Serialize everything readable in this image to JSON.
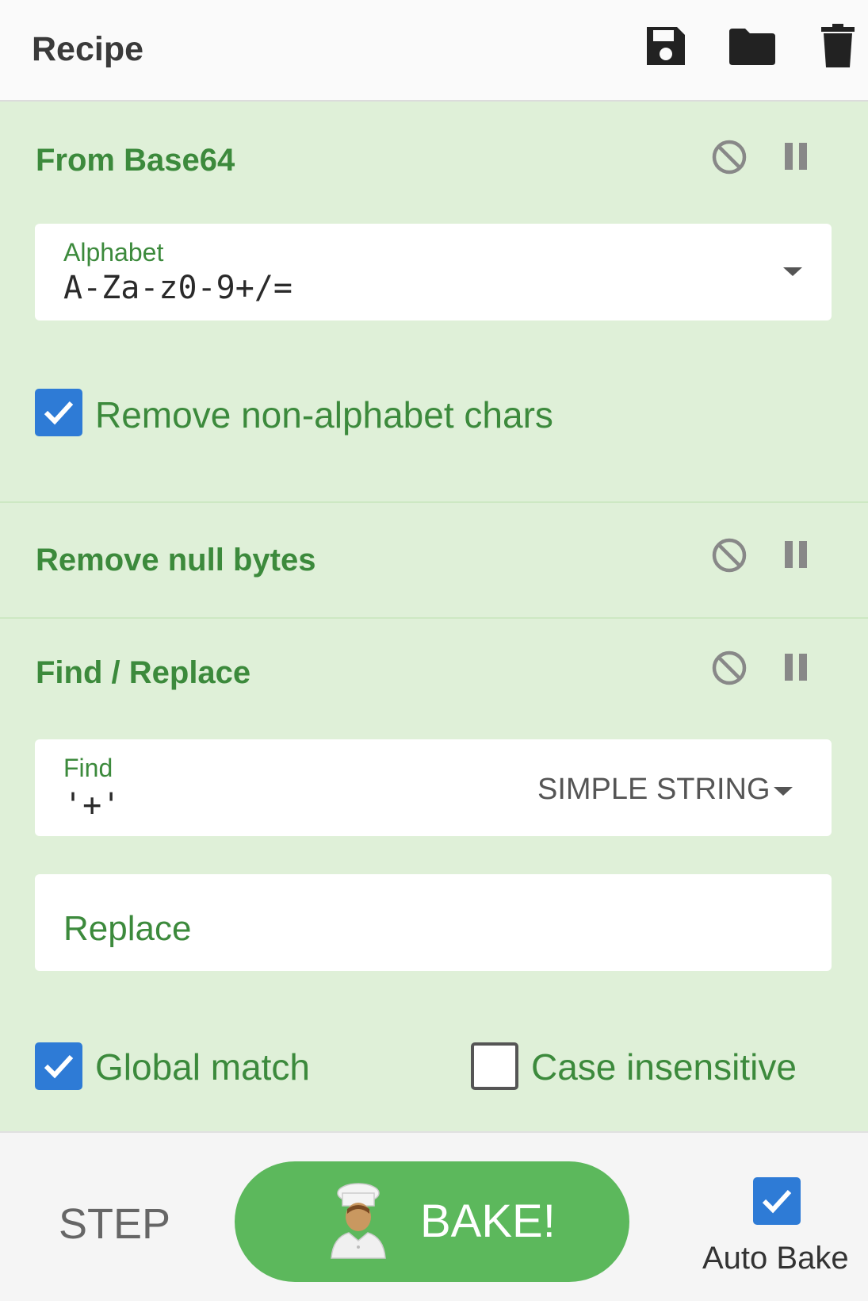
{
  "header": {
    "title": "Recipe",
    "icons": [
      "save-icon",
      "folder-icon",
      "trash-icon"
    ]
  },
  "operations": {
    "from_base64": {
      "title": "From Base64",
      "alphabet_label": "Alphabet",
      "alphabet_value": "A-Za-z0-9+/=",
      "remove_nonalpha_label": "Remove non-alphabet chars",
      "remove_nonalpha_checked": true
    },
    "remove_null": {
      "title": "Remove null bytes"
    },
    "find_replace": {
      "title": "Find / Replace",
      "find_label": "Find",
      "find_value": "'+'",
      "find_mode": "SIMPLE STRING",
      "replace_placeholder": "Replace",
      "global_label": "Global match",
      "global_checked": true,
      "case_label": "Case insensitive",
      "case_checked": false
    }
  },
  "op_controls": [
    "disable-icon",
    "breakpoint-icon"
  ],
  "footer": {
    "step_label": "STEP",
    "bake_label": "BAKE!",
    "auto_bake_label": "Auto Bake",
    "auto_bake_checked": true
  },
  "colors": {
    "recipe_bg": "#dff0d8",
    "op_title": "#3c8a3c",
    "checkbox": "#2e7bd6",
    "bake": "#5cb85c"
  }
}
